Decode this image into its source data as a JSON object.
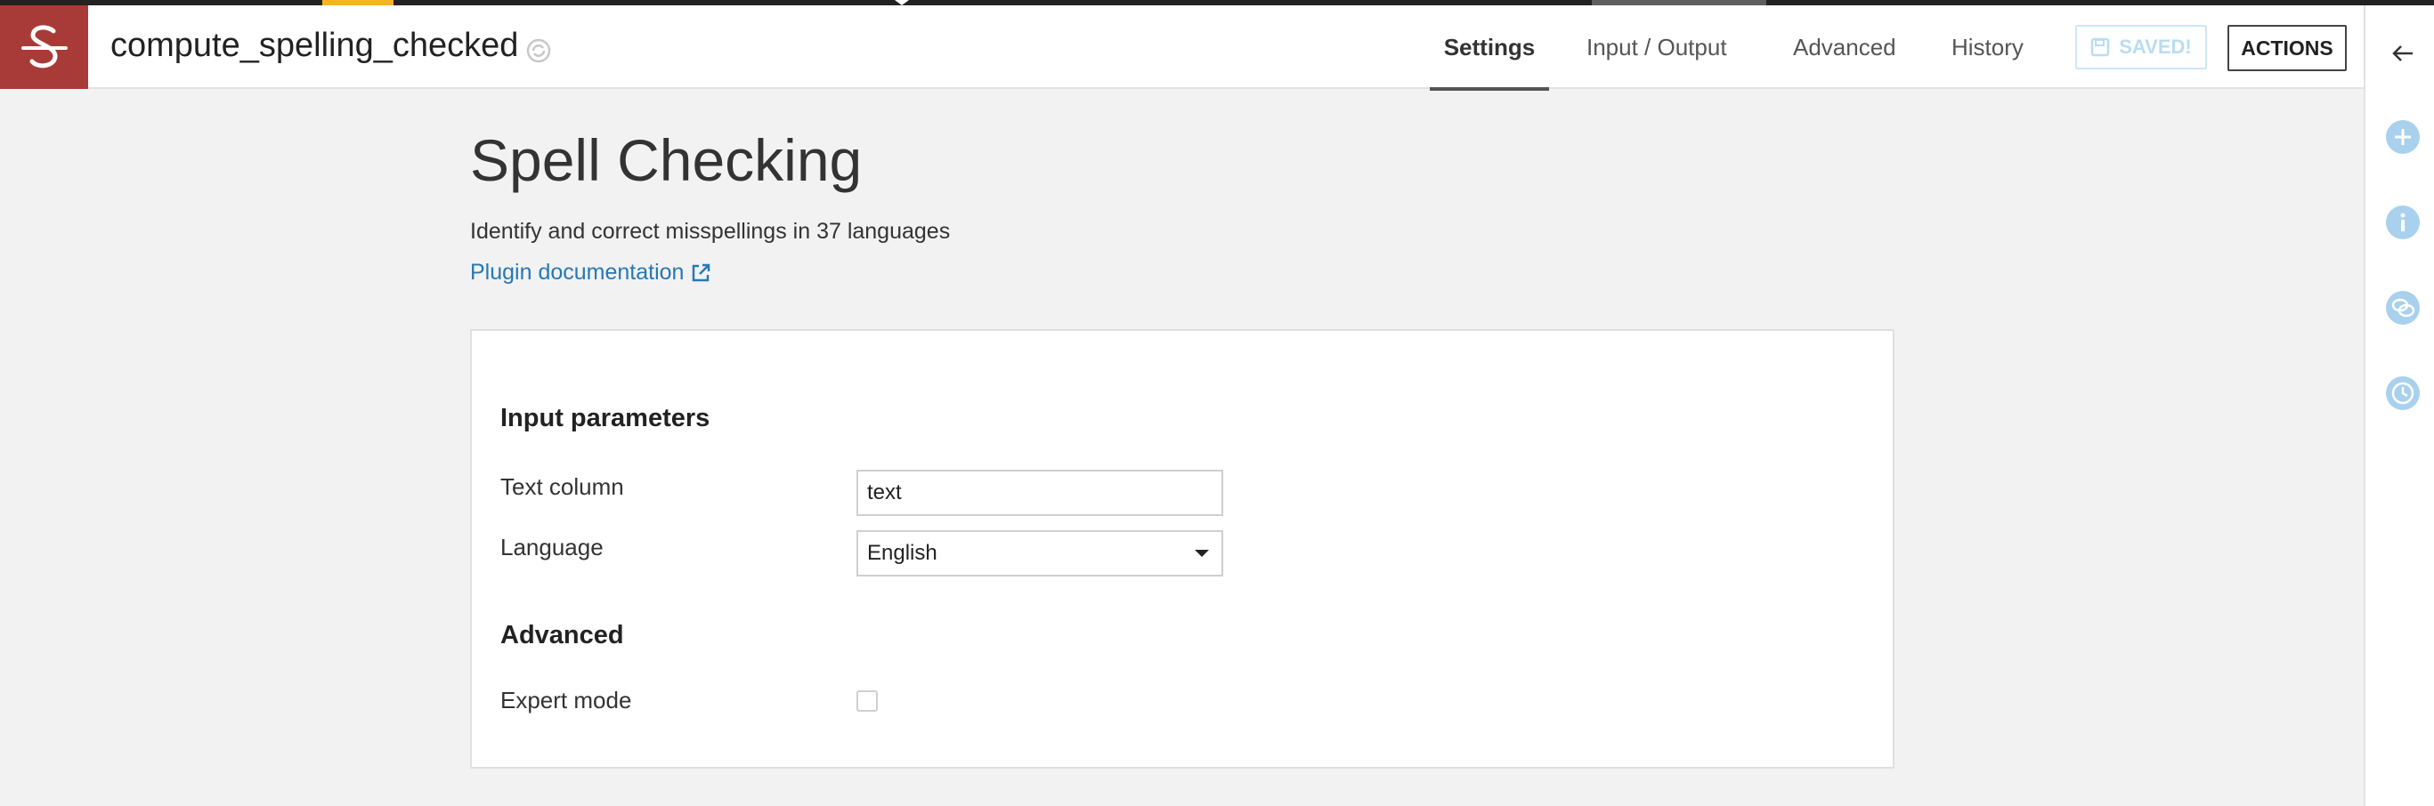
{
  "header": {
    "recipe_name": "compute_spelling_checked",
    "tabs": [
      {
        "label": "Settings",
        "active": true
      },
      {
        "label": "Input / Output",
        "active": false
      },
      {
        "label": "Advanced",
        "active": false
      },
      {
        "label": "History",
        "active": false
      }
    ],
    "saved_label": "SAVED!",
    "actions_label": "ACTIONS"
  },
  "page": {
    "title": "Spell Checking",
    "description": "Identify and correct misspellings in 37 languages",
    "doc_link": "Plugin documentation"
  },
  "form": {
    "input_section_title": "Input parameters",
    "text_column_label": "Text column",
    "text_column_value": "text",
    "language_label": "Language",
    "language_value": "English",
    "advanced_section_title": "Advanced",
    "expert_mode_label": "Expert mode",
    "expert_mode_checked": false
  },
  "rail": {
    "items": [
      "back-arrow-icon",
      "add-icon",
      "info-icon",
      "discussions-icon",
      "history-icon"
    ]
  },
  "colors": {
    "recipe_icon_bg": "#a83b37",
    "accent_blue": "#2678b6",
    "rail_icon_blue": "#a9d1ee",
    "progress_yellow": "#f4b524"
  }
}
